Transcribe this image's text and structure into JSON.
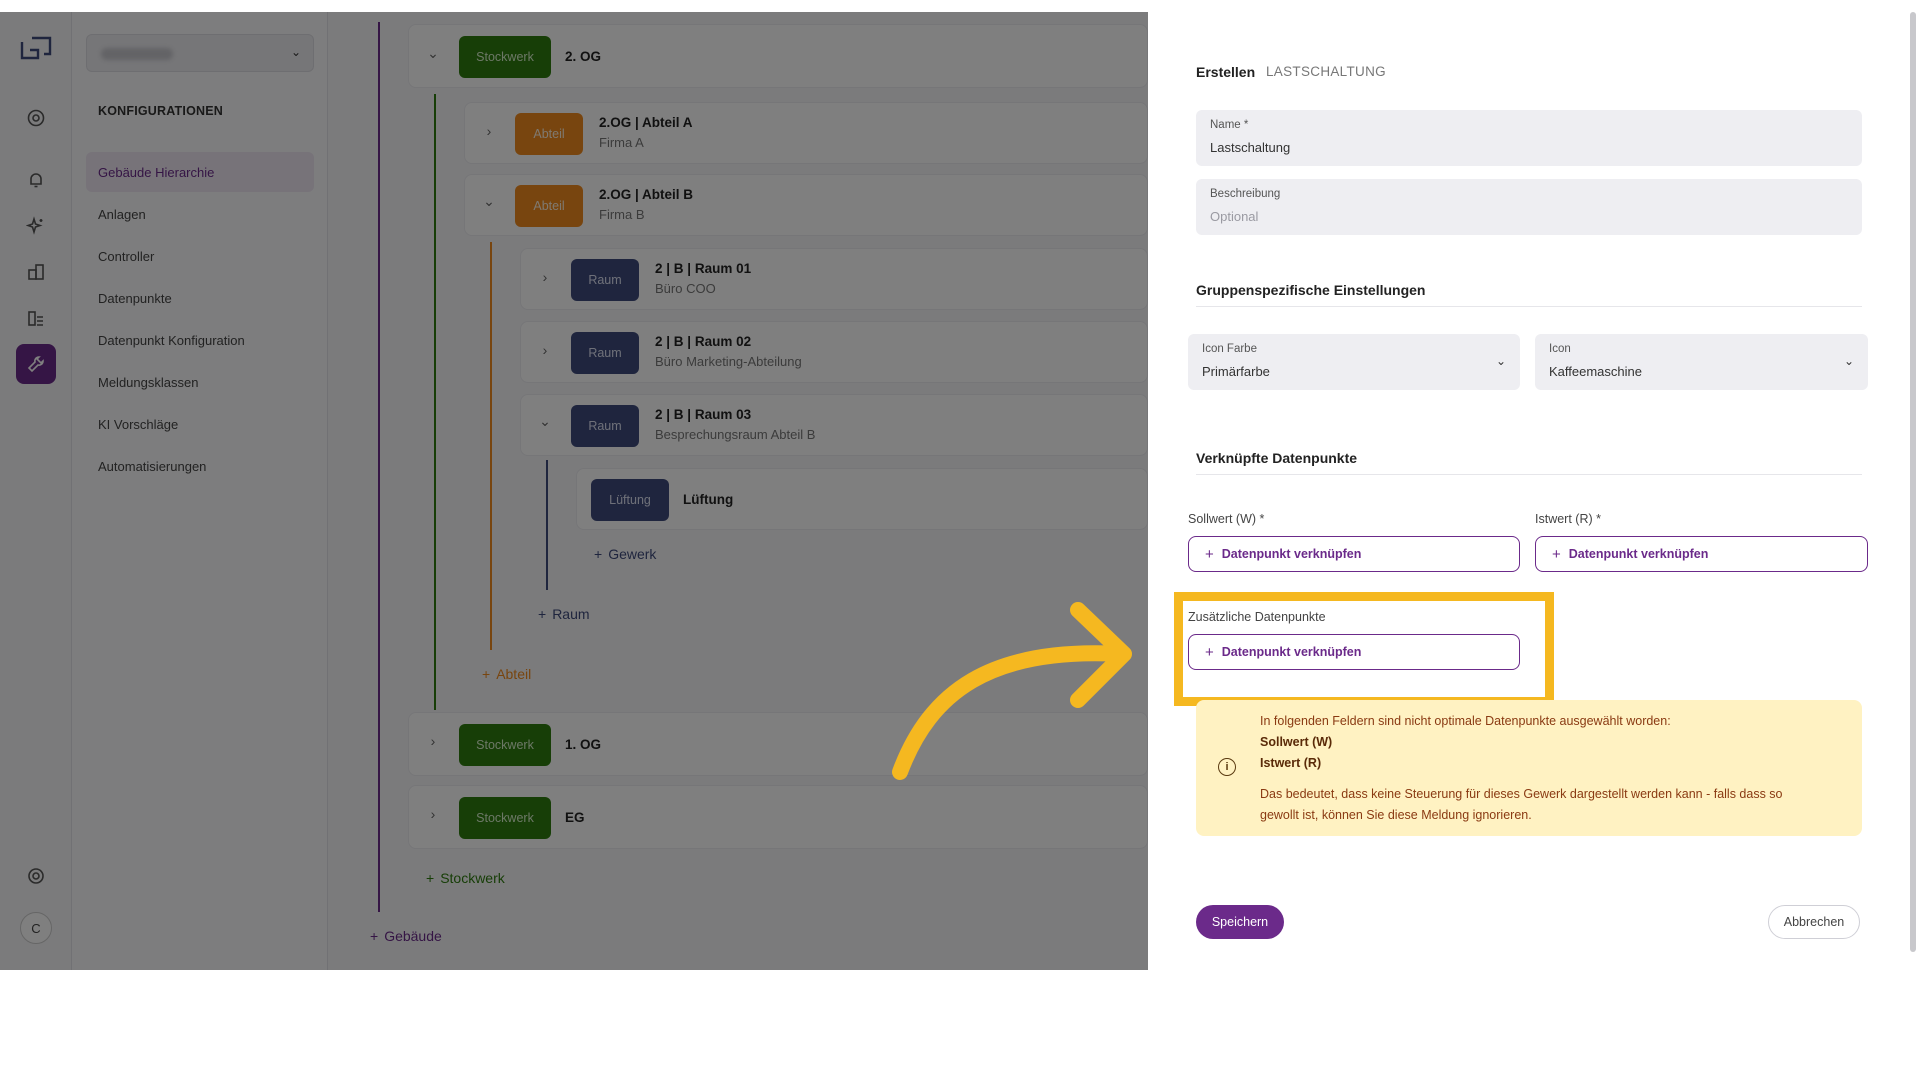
{
  "sidebar": {
    "title": "KONFIGURATIONEN",
    "items": [
      {
        "label": "Gebäude Hierarchie",
        "active": true
      },
      {
        "label": "Anlagen"
      },
      {
        "label": "Controller"
      },
      {
        "label": "Datenpunkte"
      },
      {
        "label": "Datenpunkt Konfiguration"
      },
      {
        "label": "Meldungsklassen"
      },
      {
        "label": "KI Vorschläge"
      },
      {
        "label": "Automatisierungen"
      }
    ]
  },
  "rail": {
    "icons": [
      "info-icon",
      "bell-icon",
      "sparkles-icon",
      "buildings-icon",
      "building-list-icon",
      "wrench-icon",
      "settings-icon"
    ],
    "avatar": "C"
  },
  "tree": {
    "floor_2": {
      "badge": "Stockwerk",
      "title": "2. OG"
    },
    "abteil_a": {
      "badge": "Abteil",
      "title": "2.OG | Abteil A",
      "sub": "Firma A"
    },
    "abteil_b": {
      "badge": "Abteil",
      "title": "2.OG | Abteil B",
      "sub": "Firma B"
    },
    "raum_01": {
      "badge": "Raum",
      "title": "2 | B | Raum 01",
      "sub": "Büro COO"
    },
    "raum_02": {
      "badge": "Raum",
      "title": "2 | B | Raum 02",
      "sub": "Büro Marketing-Abteilung"
    },
    "raum_03": {
      "badge": "Raum",
      "title": "2 | B | Raum 03",
      "sub": "Besprechungsraum Abteil B"
    },
    "lueftung": {
      "badge": "Lüftung",
      "title": "Lüftung"
    },
    "add_gewerk": "Gewerk",
    "add_raum": "Raum",
    "add_abteil": "Abteil",
    "floor_1": {
      "badge": "Stockwerk",
      "title": "1. OG"
    },
    "floor_eg": {
      "badge": "Stockwerk",
      "title": "EG"
    },
    "add_stockwerk": "Stockwerk",
    "add_gebaeude": "Gebäude"
  },
  "panel": {
    "crumb_action": "Erstellen",
    "crumb_type": "LASTSCHALTUNG",
    "name_label": "Name *",
    "name_value": "Lastschaltung",
    "desc_label": "Beschreibung",
    "desc_placeholder": "Optional",
    "group_title": "Gruppenspezifische Einstellungen",
    "icon_color_label": "Icon Farbe",
    "icon_color_value": "Primärfarbe",
    "icon_label": "Icon",
    "icon_value": "Kaffeemaschine",
    "linked_title": "Verknüpfte Datenpunkte",
    "sollwert_label": "Sollwert (W) *",
    "istwert_label": "Istwert (R) *",
    "link_button": "Datenpunkt verknüpfen",
    "extra_label": "Zusätzliche Datenpunkte",
    "warning": {
      "intro": "In folgenden Feldern sind nicht optimale Datenpunkte ausgewählt worden:",
      "item1": "Sollwert (W)",
      "item2": "Istwert (R)",
      "note": "Das bedeutet, dass keine Steuerung für dieses Gewerk dargestellt werden kann - falls dass so gewollt ist, können Sie diese Meldung ignorieren."
    },
    "save": "Speichern",
    "cancel": "Abbrechen"
  },
  "colors": {
    "accent": "#6b2a8a",
    "highlight": "#f5b820",
    "floor_badge": "#2e7d0f",
    "abteil_badge": "#f08b1e",
    "raum_badge": "#3f4b7c"
  }
}
